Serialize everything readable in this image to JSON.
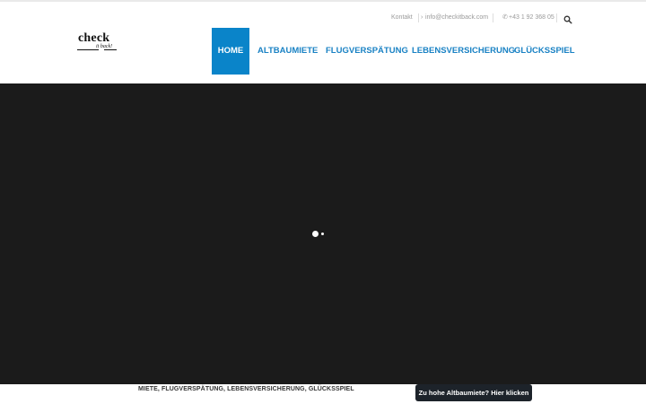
{
  "logo": {
    "main": "check",
    "sub": "it back!"
  },
  "topbar": {
    "contact": "Kontakt",
    "mail_icon": "›",
    "email": "info@checkitback.com",
    "phone_icon": "✆",
    "phone": "+43 1 92 368 05",
    "search_icon": "search-icon"
  },
  "nav": {
    "items": [
      {
        "label": "HOME"
      },
      {
        "label": "ALTBAUMIETE"
      },
      {
        "label": "FLUGVERSPÄTUNG"
      },
      {
        "label": "LEBENSVERSICHERUNG"
      },
      {
        "label": "GLÜCKSSPIEL"
      }
    ]
  },
  "bottom": {
    "categories": "MIETE, FLUGVERSPÄTUNG, LEBENSVERSICHERUNG, GLÜCKSSPIEL",
    "cta_label": "Zu hohe Altbaumiete? Hier klicken"
  },
  "colors": {
    "accent": "#0a84c9",
    "nav_text": "#1a82c4",
    "hero_bg": "#1b1b1b",
    "cta_bg": "#1d232a"
  }
}
